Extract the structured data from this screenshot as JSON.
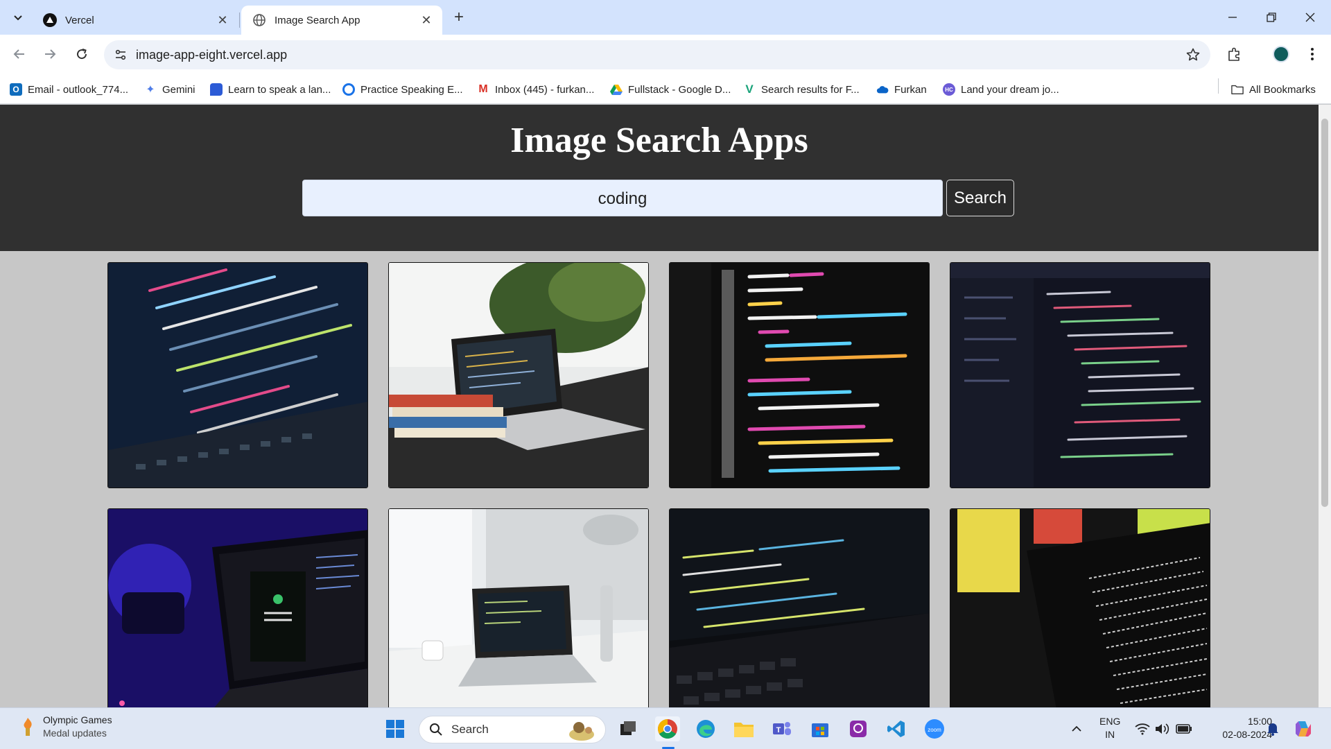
{
  "browser": {
    "tabs": [
      {
        "title": "Vercel",
        "icon": "vercel-icon",
        "active": false
      },
      {
        "title": "Image Search App",
        "icon": "globe-icon",
        "active": true
      }
    ],
    "url": "image-app-eight.vercel.app",
    "bookmarks": [
      {
        "label": "Email - outlook_774...",
        "icon": "outlook-icon"
      },
      {
        "label": "Gemini",
        "icon": "gemini-icon"
      },
      {
        "label": "Learn to speak a lan...",
        "icon": "duolingo-icon"
      },
      {
        "label": "Practice Speaking E...",
        "icon": "practice-icon"
      },
      {
        "label": "Inbox (445) - furkan...",
        "icon": "gmail-icon"
      },
      {
        "label": "Fullstack - Google D...",
        "icon": "google-drive-icon"
      },
      {
        "label": "Search results for F...",
        "icon": "bookmark-v-icon"
      },
      {
        "label": "Furkan",
        "icon": "cloud-icon"
      },
      {
        "label": "Land your dream jo...",
        "icon": "job-icon"
      }
    ],
    "all_bookmarks": "All Bookmarks"
  },
  "page": {
    "title": "Image Search Apps",
    "search_value": "coding",
    "search_button": "Search",
    "results": [
      {
        "subject": "dark code screen close-up"
      },
      {
        "subject": "laptop with books on desk"
      },
      {
        "subject": "python code on monitor"
      },
      {
        "subject": "html code editor"
      },
      {
        "subject": "laptop with purple lights"
      },
      {
        "subject": "laptop on white desk"
      },
      {
        "subject": "laptop keyboard with code"
      },
      {
        "subject": "terminal on laptop screen"
      }
    ]
  },
  "taskbar": {
    "weather_title": "Olympic Games",
    "weather_sub": "Medal updates",
    "search_placeholder": "Search",
    "lang_top": "ENG",
    "lang_bottom": "IN",
    "time": "15:00",
    "date": "02-08-2024"
  },
  "colors": {
    "tabstrip": "#d3e3fd",
    "hero_bg": "#303030",
    "page_bg": "#c7c7c7",
    "input_bg": "#e8f0fe"
  }
}
